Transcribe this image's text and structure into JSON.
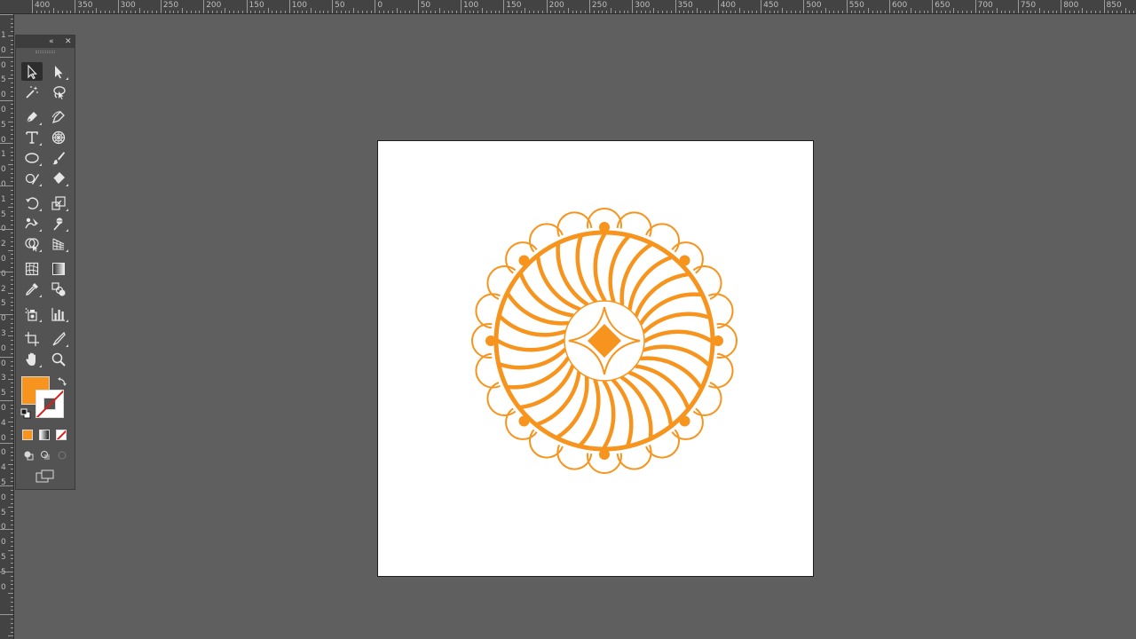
{
  "ruler_h": {
    "labels": [
      "400",
      "350",
      "300",
      "250",
      "200",
      "150",
      "100",
      "50",
      "0",
      "50",
      "100",
      "150",
      "200",
      "250",
      "300",
      "350",
      "400",
      "450",
      "500",
      "550",
      "600",
      "650",
      "700",
      "750",
      "800",
      "850"
    ]
  },
  "ruler_v": {
    "labels": [
      "1",
      "0",
      "0",
      "5",
      "0",
      "0",
      "5",
      "0",
      "1",
      "0",
      "0",
      "1",
      "5",
      "0",
      "2",
      "0",
      "0",
      "2",
      "5",
      "0",
      "3",
      "0",
      "0",
      "3",
      "5",
      "0",
      "4",
      "0",
      "0",
      "4",
      "5",
      "0",
      "5",
      "0",
      "0",
      "5",
      "5",
      "0"
    ]
  },
  "toolbar": {
    "collapse_icon": "«",
    "close_icon": "✕",
    "tools": [
      {
        "name": "selection-tool",
        "icon": "selection-arrow-icon"
      },
      {
        "name": "direct-selection-tool",
        "icon": "direct-selection-icon"
      },
      {
        "name": "magic-wand-tool",
        "icon": "magic-wand-icon"
      },
      {
        "name": "lasso-tool",
        "icon": "lasso-icon"
      },
      {
        "name": "pen-tool",
        "icon": "pen-icon"
      },
      {
        "name": "curvature-tool",
        "icon": "curvature-icon"
      },
      {
        "name": "type-tool",
        "icon": "type-icon",
        "label": "T"
      },
      {
        "name": "spiral-tool",
        "icon": "spiral-icon"
      },
      {
        "name": "ellipse-tool",
        "icon": "ellipse-icon"
      },
      {
        "name": "paintbrush-tool",
        "icon": "paintbrush-icon"
      },
      {
        "name": "shaper-tool",
        "icon": "shaper-icon"
      },
      {
        "name": "eraser-tool",
        "icon": "eraser-icon"
      },
      {
        "name": "rotate-tool",
        "icon": "rotate-icon"
      },
      {
        "name": "scale-tool",
        "icon": "scale-icon"
      },
      {
        "name": "warp-tool",
        "icon": "warp-icon"
      },
      {
        "name": "puppet-warp-tool",
        "icon": "puppet-warp-icon"
      },
      {
        "name": "shape-builder-tool",
        "icon": "shape-builder-icon"
      },
      {
        "name": "perspective-grid-tool",
        "icon": "perspective-grid-icon"
      },
      {
        "name": "mesh-tool",
        "icon": "mesh-icon"
      },
      {
        "name": "gradient-tool",
        "icon": "gradient-icon"
      },
      {
        "name": "eyedropper-tool",
        "icon": "eyedropper-icon"
      },
      {
        "name": "blend-tool",
        "icon": "blend-icon"
      },
      {
        "name": "symbol-sprayer-tool",
        "icon": "symbol-sprayer-icon"
      },
      {
        "name": "column-graph-tool",
        "icon": "column-graph-icon"
      },
      {
        "name": "artboard-tool",
        "icon": "artboard-icon"
      },
      {
        "name": "slice-tool",
        "icon": "slice-icon"
      },
      {
        "name": "hand-tool",
        "icon": "hand-icon"
      },
      {
        "name": "zoom-tool",
        "icon": "zoom-icon"
      }
    ],
    "fill_color": "#f7941d",
    "stroke": "none"
  },
  "colors": {
    "accent": "#f7941d",
    "canvas_bg": "#5f5f5f",
    "panel_bg": "#535353",
    "artboard": "#ffffff"
  }
}
